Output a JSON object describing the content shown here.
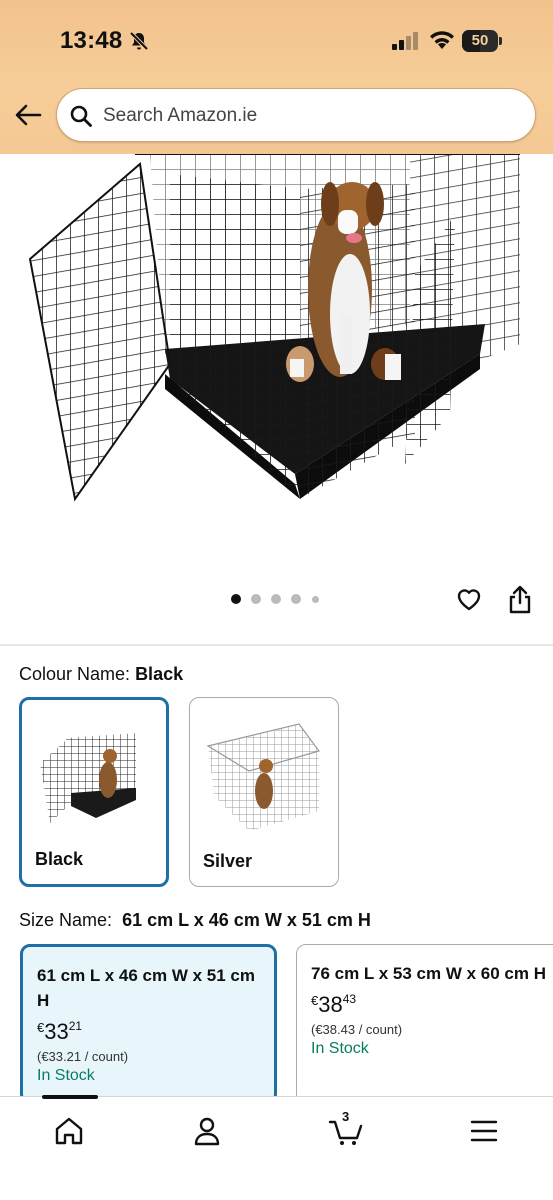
{
  "status_bar": {
    "time": "13:48",
    "battery": "50",
    "battery_level": 0.5
  },
  "search": {
    "placeholder": "Search Amazon.ie"
  },
  "gallery": {
    "image_count": 5,
    "active_index": 0
  },
  "colour": {
    "label": "Colour Name:",
    "selected": "Black",
    "options": [
      {
        "label": "Black"
      },
      {
        "label": "Silver"
      }
    ]
  },
  "size": {
    "label": "Size Name:",
    "selected": "61 cm L x 46 cm W x 51 cm H",
    "options": [
      {
        "name": "61 cm L x 46 cm W x 51 cm H",
        "currency": "€",
        "price_whole": "33",
        "price_fraction": "21",
        "unit_price": "(€33.21 / count)",
        "stock": "In Stock"
      },
      {
        "name": "76 cm L x 53 cm W x 60 cm H",
        "currency": "€",
        "price_whole": "38",
        "price_fraction": "43",
        "unit_price": "(€38.43 / count)",
        "stock": "In Stock"
      }
    ]
  },
  "tab_bar": {
    "cart_count": "3"
  },
  "colors": {
    "header": "#f6cd98",
    "selected_border": "#1d6fa5",
    "in_stock": "#067d62"
  }
}
